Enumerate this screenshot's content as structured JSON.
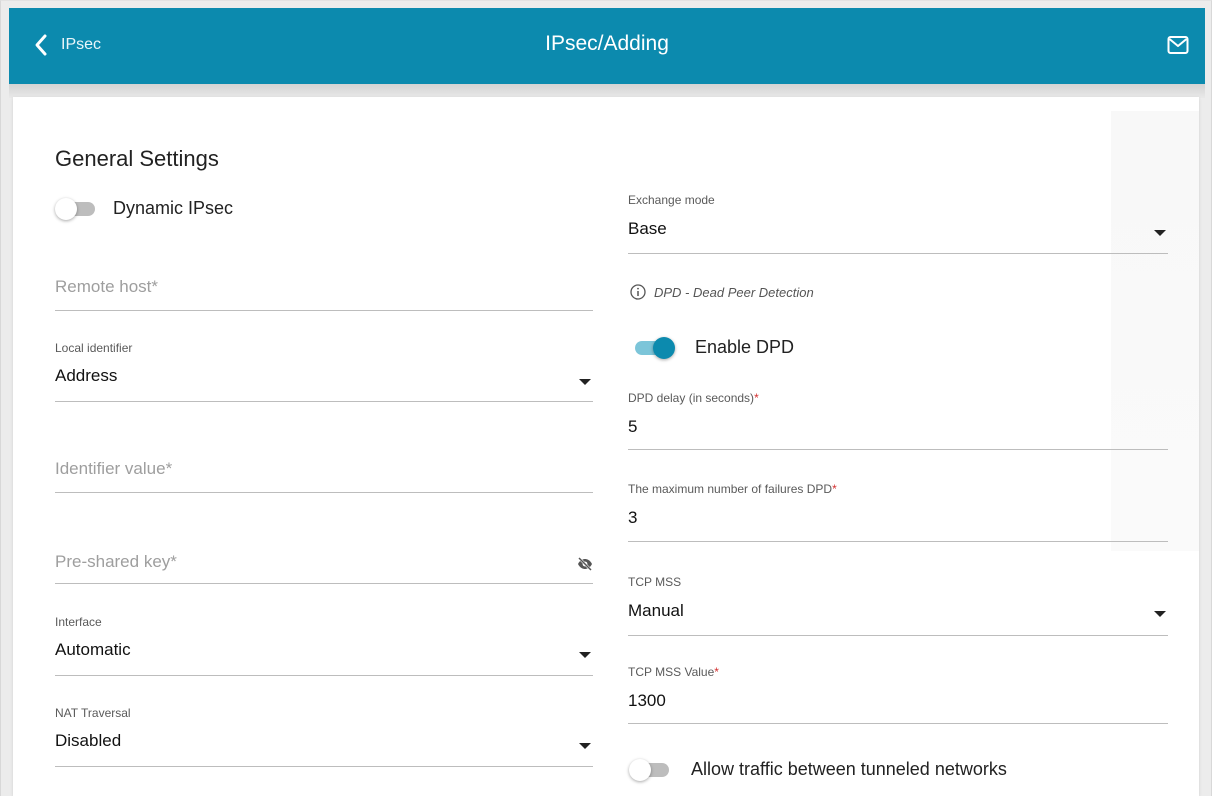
{
  "header": {
    "back_label": "IPsec",
    "title": "IPsec/Adding",
    "back_icon": "chevron-left-icon",
    "mail_icon": "mail-icon",
    "bg_color": "#0c8aae"
  },
  "section": {
    "title": "General Settings"
  },
  "dynamic_ipsec": {
    "label": "Dynamic IPsec",
    "enabled": false
  },
  "remote_host": {
    "placeholder": "Remote host",
    "required_mark": "*",
    "value": ""
  },
  "local_identifier": {
    "label": "Local identifier",
    "value": "Address"
  },
  "identifier_value": {
    "placeholder": "Identifier value",
    "required_mark": "*",
    "value": ""
  },
  "pre_shared_key": {
    "placeholder": "Pre-shared key",
    "required_mark": "*",
    "value": "",
    "icon": "eye-off-icon"
  },
  "interface": {
    "label": "Interface",
    "value": "Automatic"
  },
  "nat_traversal": {
    "label": "NAT Traversal",
    "value": "Disabled"
  },
  "exchange_mode": {
    "label": "Exchange mode",
    "value": "Base"
  },
  "dpd_info": {
    "text": "DPD - Dead Peer Detection",
    "icon": "info-icon"
  },
  "enable_dpd": {
    "label": "Enable DPD",
    "enabled": true
  },
  "dpd_delay": {
    "label": "DPD delay (in seconds)",
    "required_mark": "*",
    "value": "5"
  },
  "dpd_failures": {
    "label": "The maximum number of failures DPD",
    "required_mark": "*",
    "value": "3"
  },
  "tcp_mss": {
    "label": "TCP MSS",
    "value": "Manual"
  },
  "tcp_mss_value": {
    "label": "TCP MSS Value",
    "required_mark": "*",
    "value": "1300"
  },
  "allow_traffic": {
    "label": "Allow traffic between tunneled networks",
    "enabled": false
  }
}
